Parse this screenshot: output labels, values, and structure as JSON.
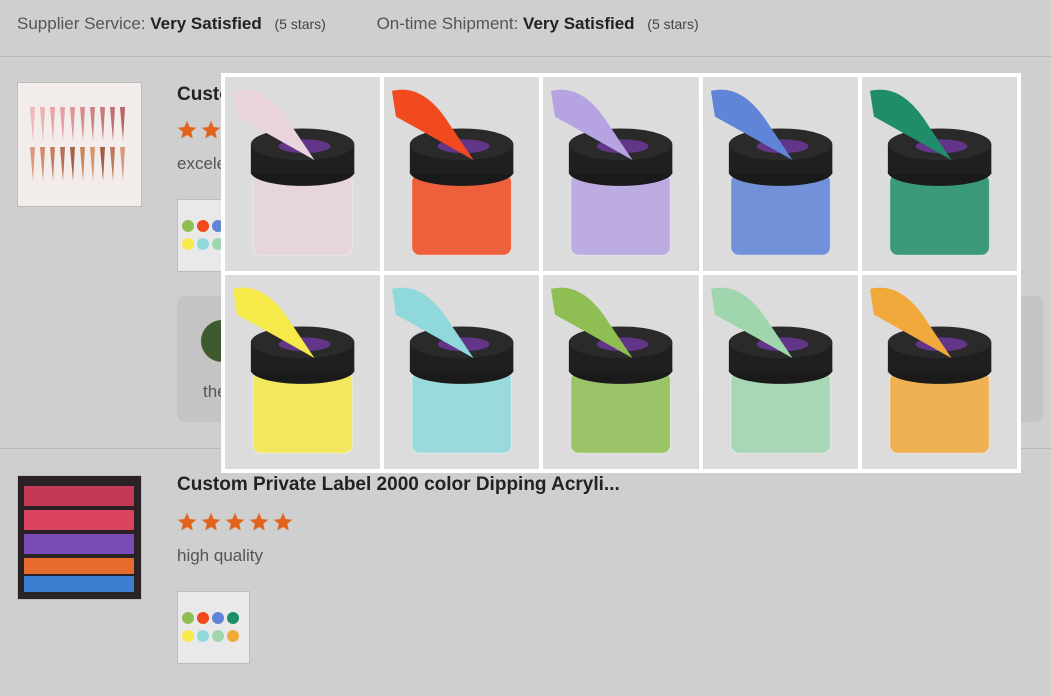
{
  "ratings": [
    {
      "label": "Supplier Service:",
      "value": "Very Satisfied",
      "stars_text": "(5 stars)"
    },
    {
      "label": "On-time Shipment:",
      "value": "Very Satisfied",
      "stars_text": "(5 stars)"
    }
  ],
  "reviews": [
    {
      "title": "Custo",
      "comment": "excele",
      "stars": 5,
      "reply_text": "the"
    },
    {
      "title": "Custom Private Label 2000 color Dipping Acryli...",
      "comment": "high quality",
      "stars": 5
    }
  ],
  "colors": {
    "star": "#e0621b",
    "swatches": [
      "#e9d3dc",
      "#f04a1e",
      "#b6a3e2",
      "#5f84d8",
      "#1f8d6a",
      "#f5ea4a",
      "#8fd9dc",
      "#8fbf53",
      "#9fd6ae",
      "#f2a93b"
    ]
  }
}
